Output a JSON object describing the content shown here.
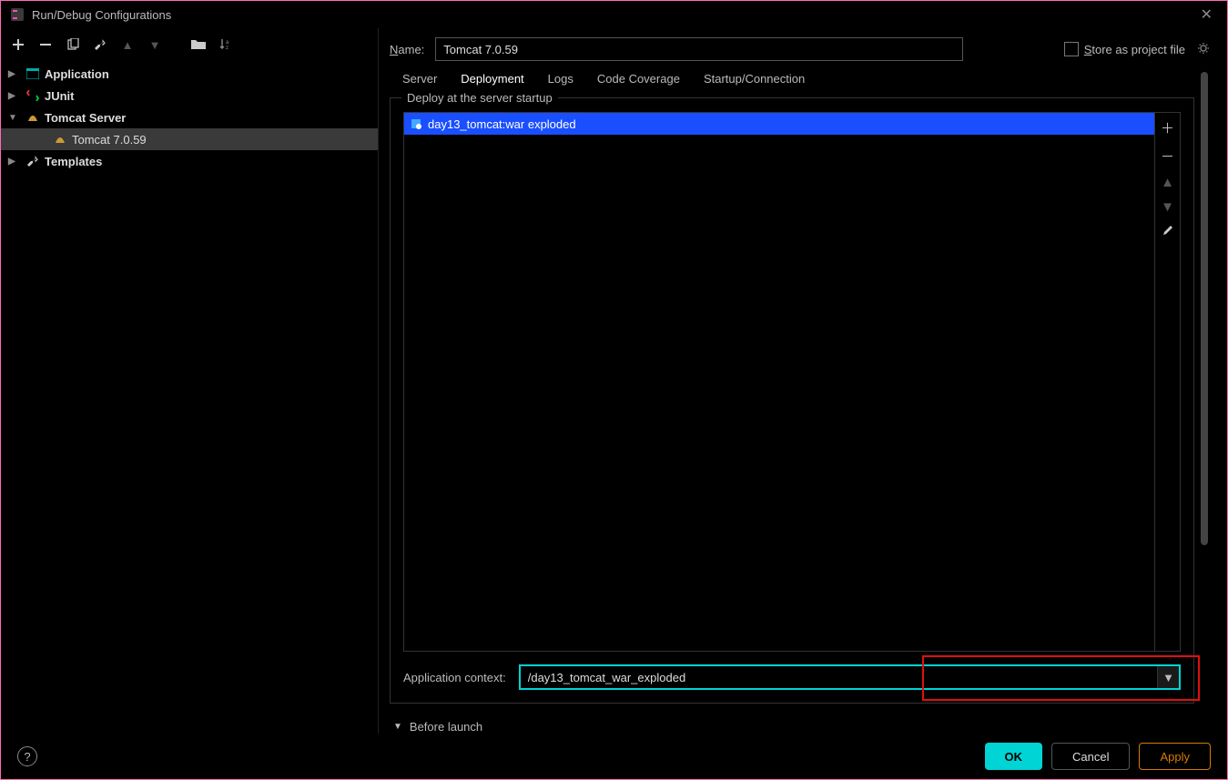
{
  "window": {
    "title": "Run/Debug Configurations"
  },
  "sidebar": {
    "items": [
      {
        "label": "Application",
        "expandable": true
      },
      {
        "label": "JUnit",
        "expandable": true
      },
      {
        "label": "Tomcat Server",
        "expandable": true,
        "expanded": true
      },
      {
        "label": "Tomcat 7.0.59",
        "child": true,
        "selected": true
      },
      {
        "label": "Templates",
        "expandable": true
      }
    ]
  },
  "name": {
    "label": "Name:",
    "value": "Tomcat 7.0.59"
  },
  "store": {
    "label": "Store as project file"
  },
  "tabs": {
    "server": "Server",
    "deployment": "Deployment",
    "logs": "Logs",
    "coverage": "Code Coverage",
    "startup": "Startup/Connection"
  },
  "deploy": {
    "title": "Deploy at the server startup",
    "artifact": "day13_tomcat:war exploded"
  },
  "appctx": {
    "label": "Application context:",
    "value": "/day13_tomcat_war_exploded"
  },
  "before_launch": "Before launch",
  "buttons": {
    "ok": "OK",
    "cancel": "Cancel",
    "apply": "Apply"
  }
}
